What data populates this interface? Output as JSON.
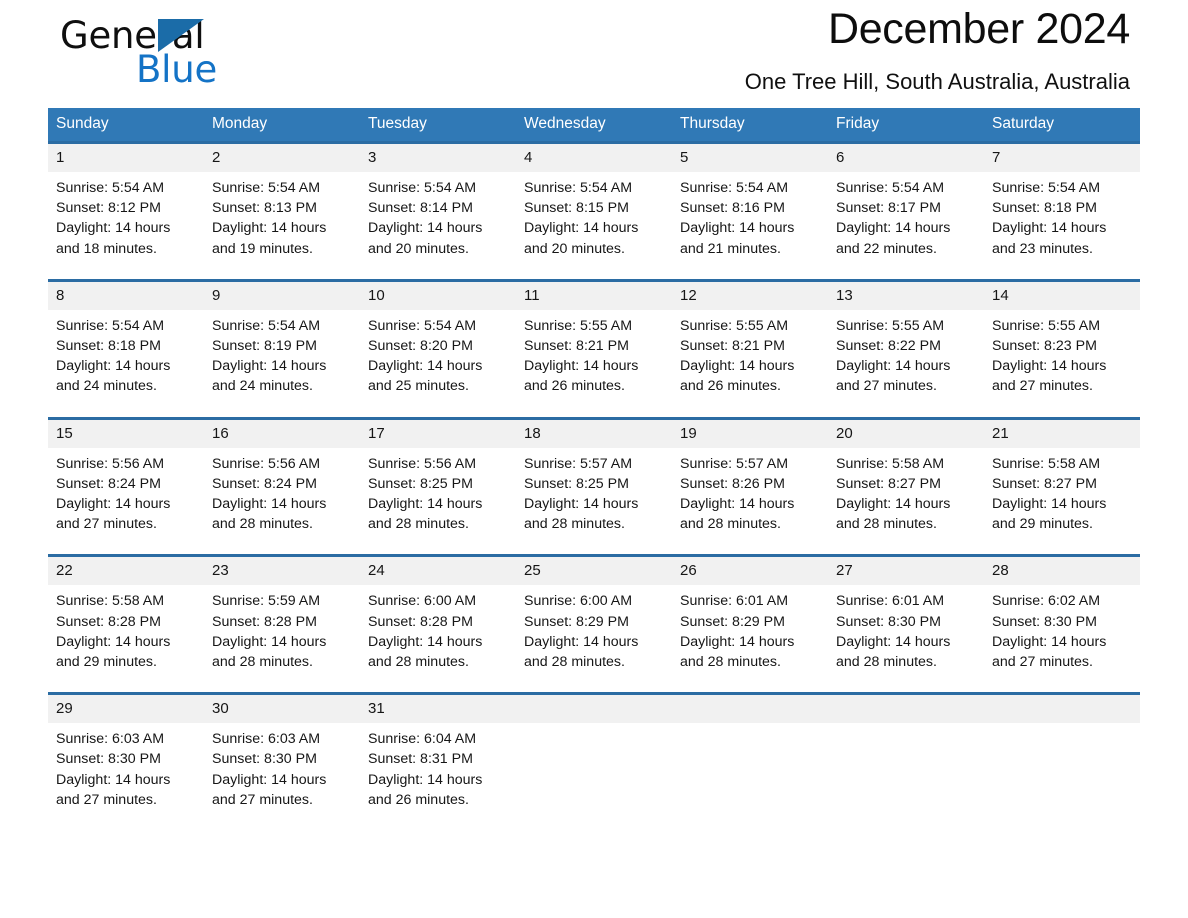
{
  "logo": {
    "word1": "General",
    "word2": "Blue",
    "triangle": "triangle-mark",
    "accent_color": "#1473c6"
  },
  "header": {
    "title": "December 2024",
    "subtitle": "One Tree Hill, South Australia, Australia"
  },
  "theme": {
    "header_blue": "#3079b6",
    "row_border_blue": "#2b6ca3",
    "daynum_band": "#f1f1f1"
  },
  "calendar": {
    "weekdays": [
      "Sunday",
      "Monday",
      "Tuesday",
      "Wednesday",
      "Thursday",
      "Friday",
      "Saturday"
    ],
    "weeks": [
      [
        {
          "day": "1",
          "sunrise": "Sunrise: 5:54 AM",
          "sunset": "Sunset: 8:12 PM",
          "daylight": "Daylight: 14 hours and 18 minutes."
        },
        {
          "day": "2",
          "sunrise": "Sunrise: 5:54 AM",
          "sunset": "Sunset: 8:13 PM",
          "daylight": "Daylight: 14 hours and 19 minutes."
        },
        {
          "day": "3",
          "sunrise": "Sunrise: 5:54 AM",
          "sunset": "Sunset: 8:14 PM",
          "daylight": "Daylight: 14 hours and 20 minutes."
        },
        {
          "day": "4",
          "sunrise": "Sunrise: 5:54 AM",
          "sunset": "Sunset: 8:15 PM",
          "daylight": "Daylight: 14 hours and 20 minutes."
        },
        {
          "day": "5",
          "sunrise": "Sunrise: 5:54 AM",
          "sunset": "Sunset: 8:16 PM",
          "daylight": "Daylight: 14 hours and 21 minutes."
        },
        {
          "day": "6",
          "sunrise": "Sunrise: 5:54 AM",
          "sunset": "Sunset: 8:17 PM",
          "daylight": "Daylight: 14 hours and 22 minutes."
        },
        {
          "day": "7",
          "sunrise": "Sunrise: 5:54 AM",
          "sunset": "Sunset: 8:18 PM",
          "daylight": "Daylight: 14 hours and 23 minutes."
        }
      ],
      [
        {
          "day": "8",
          "sunrise": "Sunrise: 5:54 AM",
          "sunset": "Sunset: 8:18 PM",
          "daylight": "Daylight: 14 hours and 24 minutes."
        },
        {
          "day": "9",
          "sunrise": "Sunrise: 5:54 AM",
          "sunset": "Sunset: 8:19 PM",
          "daylight": "Daylight: 14 hours and 24 minutes."
        },
        {
          "day": "10",
          "sunrise": "Sunrise: 5:54 AM",
          "sunset": "Sunset: 8:20 PM",
          "daylight": "Daylight: 14 hours and 25 minutes."
        },
        {
          "day": "11",
          "sunrise": "Sunrise: 5:55 AM",
          "sunset": "Sunset: 8:21 PM",
          "daylight": "Daylight: 14 hours and 26 minutes."
        },
        {
          "day": "12",
          "sunrise": "Sunrise: 5:55 AM",
          "sunset": "Sunset: 8:21 PM",
          "daylight": "Daylight: 14 hours and 26 minutes."
        },
        {
          "day": "13",
          "sunrise": "Sunrise: 5:55 AM",
          "sunset": "Sunset: 8:22 PM",
          "daylight": "Daylight: 14 hours and 27 minutes."
        },
        {
          "day": "14",
          "sunrise": "Sunrise: 5:55 AM",
          "sunset": "Sunset: 8:23 PM",
          "daylight": "Daylight: 14 hours and 27 minutes."
        }
      ],
      [
        {
          "day": "15",
          "sunrise": "Sunrise: 5:56 AM",
          "sunset": "Sunset: 8:24 PM",
          "daylight": "Daylight: 14 hours and 27 minutes."
        },
        {
          "day": "16",
          "sunrise": "Sunrise: 5:56 AM",
          "sunset": "Sunset: 8:24 PM",
          "daylight": "Daylight: 14 hours and 28 minutes."
        },
        {
          "day": "17",
          "sunrise": "Sunrise: 5:56 AM",
          "sunset": "Sunset: 8:25 PM",
          "daylight": "Daylight: 14 hours and 28 minutes."
        },
        {
          "day": "18",
          "sunrise": "Sunrise: 5:57 AM",
          "sunset": "Sunset: 8:25 PM",
          "daylight": "Daylight: 14 hours and 28 minutes."
        },
        {
          "day": "19",
          "sunrise": "Sunrise: 5:57 AM",
          "sunset": "Sunset: 8:26 PM",
          "daylight": "Daylight: 14 hours and 28 minutes."
        },
        {
          "day": "20",
          "sunrise": "Sunrise: 5:58 AM",
          "sunset": "Sunset: 8:27 PM",
          "daylight": "Daylight: 14 hours and 28 minutes."
        },
        {
          "day": "21",
          "sunrise": "Sunrise: 5:58 AM",
          "sunset": "Sunset: 8:27 PM",
          "daylight": "Daylight: 14 hours and 29 minutes."
        }
      ],
      [
        {
          "day": "22",
          "sunrise": "Sunrise: 5:58 AM",
          "sunset": "Sunset: 8:28 PM",
          "daylight": "Daylight: 14 hours and 29 minutes."
        },
        {
          "day": "23",
          "sunrise": "Sunrise: 5:59 AM",
          "sunset": "Sunset: 8:28 PM",
          "daylight": "Daylight: 14 hours and 28 minutes."
        },
        {
          "day": "24",
          "sunrise": "Sunrise: 6:00 AM",
          "sunset": "Sunset: 8:28 PM",
          "daylight": "Daylight: 14 hours and 28 minutes."
        },
        {
          "day": "25",
          "sunrise": "Sunrise: 6:00 AM",
          "sunset": "Sunset: 8:29 PM",
          "daylight": "Daylight: 14 hours and 28 minutes."
        },
        {
          "day": "26",
          "sunrise": "Sunrise: 6:01 AM",
          "sunset": "Sunset: 8:29 PM",
          "daylight": "Daylight: 14 hours and 28 minutes."
        },
        {
          "day": "27",
          "sunrise": "Sunrise: 6:01 AM",
          "sunset": "Sunset: 8:30 PM",
          "daylight": "Daylight: 14 hours and 28 minutes."
        },
        {
          "day": "28",
          "sunrise": "Sunrise: 6:02 AM",
          "sunset": "Sunset: 8:30 PM",
          "daylight": "Daylight: 14 hours and 27 minutes."
        }
      ],
      [
        {
          "day": "29",
          "sunrise": "Sunrise: 6:03 AM",
          "sunset": "Sunset: 8:30 PM",
          "daylight": "Daylight: 14 hours and 27 minutes."
        },
        {
          "day": "30",
          "sunrise": "Sunrise: 6:03 AM",
          "sunset": "Sunset: 8:30 PM",
          "daylight": "Daylight: 14 hours and 27 minutes."
        },
        {
          "day": "31",
          "sunrise": "Sunrise: 6:04 AM",
          "sunset": "Sunset: 8:31 PM",
          "daylight": "Daylight: 14 hours and 26 minutes."
        },
        {
          "day": "",
          "sunrise": "",
          "sunset": "",
          "daylight": ""
        },
        {
          "day": "",
          "sunrise": "",
          "sunset": "",
          "daylight": ""
        },
        {
          "day": "",
          "sunrise": "",
          "sunset": "",
          "daylight": ""
        },
        {
          "day": "",
          "sunrise": "",
          "sunset": "",
          "daylight": ""
        }
      ]
    ]
  }
}
